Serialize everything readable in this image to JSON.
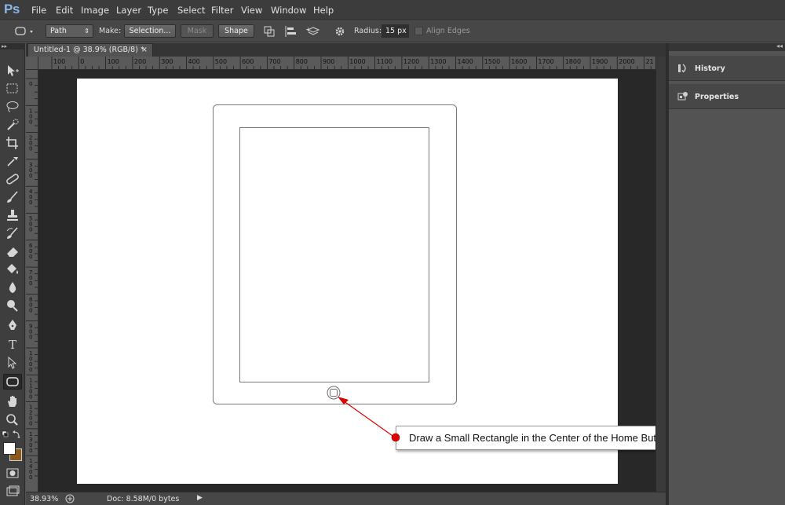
{
  "app": {
    "logo": "Ps",
    "menu": [
      "File",
      "Edit",
      "Image",
      "Layer",
      "Type",
      "Select",
      "Filter",
      "View",
      "Window",
      "Help"
    ]
  },
  "options": {
    "mode": "Path",
    "make_label": "Make:",
    "selection_label": "Selection...",
    "mask_label": "Mask",
    "shape_label": "Shape",
    "radius_label": "Radius:",
    "radius_value": "15 px",
    "align_edges_label": "Align Edges"
  },
  "document": {
    "tab_title": "Untitled-1 @ 38.9% (RGB/8) *",
    "tab_close": "×",
    "hruler_labels": [
      "100",
      "0",
      "100",
      "200",
      "300",
      "400",
      "500",
      "600",
      "700",
      "800",
      "900",
      "1000",
      "1100",
      "1200",
      "1300",
      "1400",
      "1500",
      "1600",
      "1700",
      "1800",
      "1900",
      "2000",
      "21"
    ],
    "vruler_labels": [
      "0",
      "1\n0\n0",
      "2\n0\n0",
      "3\n0\n0",
      "4\n0\n0",
      "5\n0\n0",
      "6\n0\n0",
      "7\n0\n0",
      "8\n0\n0",
      "9\n0\n0",
      "1\n0\n0\n0",
      "1\n1\n0\n0",
      "1\n2\n0\n0",
      "1\n3\n0\n0",
      "1\n4\n0\n0"
    ]
  },
  "status": {
    "zoom": "38.93%",
    "doc": "Doc: 8.58M/0 bytes"
  },
  "panels": {
    "history": "History",
    "properties": "Properties"
  },
  "annotation": {
    "text": "Draw a Small Rectangle in the Center of the Home Button",
    "color": "#e00000"
  },
  "colors": {
    "foreground": "#ffffff",
    "background": "#8b5a1a"
  }
}
